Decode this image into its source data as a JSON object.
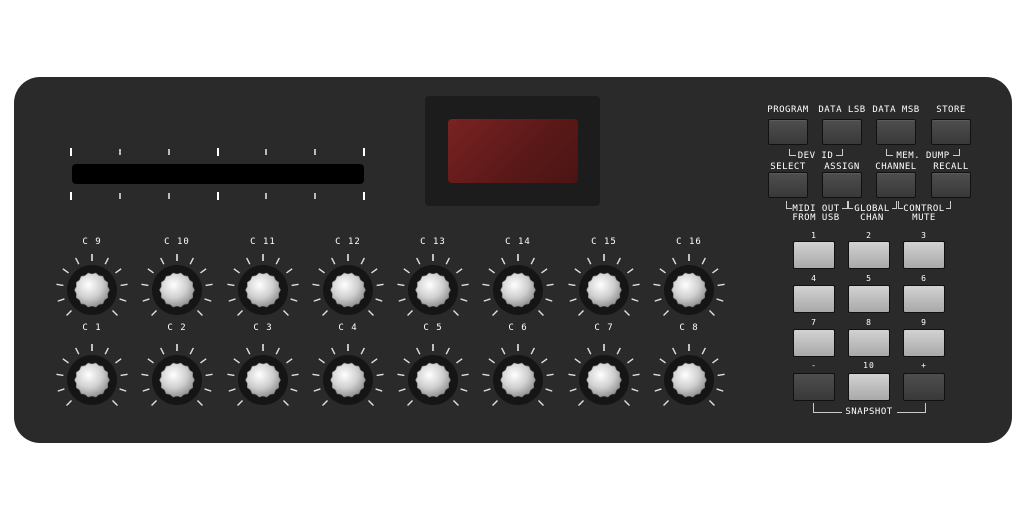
{
  "device": {
    "display": {
      "text": ""
    },
    "knobs_top": [
      {
        "label": "C 9"
      },
      {
        "label": "C 10"
      },
      {
        "label": "C 11"
      },
      {
        "label": "C 12"
      },
      {
        "label": "C 13"
      },
      {
        "label": "C 14"
      },
      {
        "label": "C 15"
      },
      {
        "label": "C 16"
      }
    ],
    "knobs_bottom": [
      {
        "label": "C 1"
      },
      {
        "label": "C 2"
      },
      {
        "label": "C 3"
      },
      {
        "label": "C 4"
      },
      {
        "label": "C 5"
      },
      {
        "label": "C 6"
      },
      {
        "label": "C 7"
      },
      {
        "label": "C 8"
      }
    ],
    "function_row1": [
      {
        "label": "PROGRAM"
      },
      {
        "label": "DATA LSB"
      },
      {
        "label": "DATA MSB"
      },
      {
        "label": "STORE"
      }
    ],
    "function_row2": [
      {
        "label": "SELECT"
      },
      {
        "label": "ASSIGN"
      },
      {
        "label": "CHANNEL"
      },
      {
        "label": "RECALL"
      }
    ],
    "groups": {
      "dev_id": "DEV ID",
      "mem_dump": "MEM. DUMP",
      "midi_out_line1": "MIDI OUT",
      "midi_out_line2": "FROM USB",
      "global_line1": "GLOBAL",
      "global_line2": "CHAN",
      "control_line1": "CONTROL",
      "control_line2": "MUTE",
      "snapshot": "SNAPSHOT"
    },
    "numpad": [
      {
        "label": "1"
      },
      {
        "label": "2"
      },
      {
        "label": "3"
      },
      {
        "label": "4"
      },
      {
        "label": "5"
      },
      {
        "label": "6"
      },
      {
        "label": "7"
      },
      {
        "label": "8"
      },
      {
        "label": "9"
      },
      {
        "label": "-"
      },
      {
        "label": "10"
      },
      {
        "label": "+"
      }
    ],
    "colors": {
      "body": "#2a2a2a",
      "display": "#6a1c1c",
      "knob": "#d6d6d6",
      "numpad_button": "#c0c0c0"
    }
  }
}
